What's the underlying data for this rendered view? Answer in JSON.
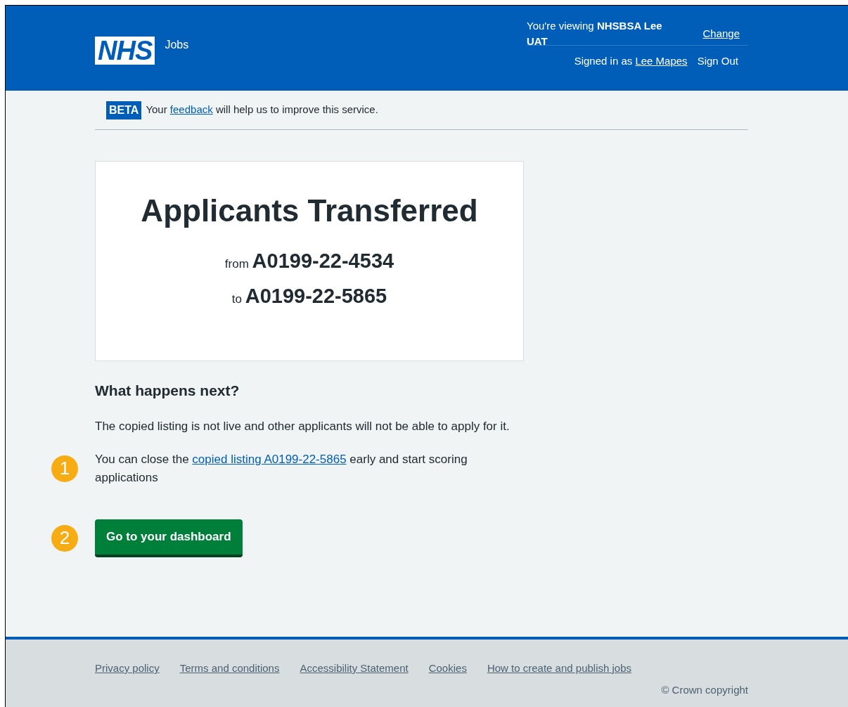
{
  "header": {
    "logo": "NHS",
    "service": "Jobs",
    "viewing_prefix": "You're viewing",
    "viewing_org": "NHSBSA Lee UAT",
    "change_link": "Change",
    "signed_in_prefix": "Signed in as",
    "user_link": "Lee Mapes",
    "sign_out": "Sign Out"
  },
  "beta_banner": {
    "tag": "BETA",
    "text_before": "Your",
    "link": "feedback",
    "text_after": "will help us to improve this service."
  },
  "panel": {
    "title": "Applicants Transferred",
    "from_label": "from",
    "from_ref": "A0199-22-4534",
    "to_label": "to",
    "to_ref": "A0199-22-5865"
  },
  "next": {
    "heading": "What happens next?",
    "paragraph": "The copied listing is not live and other applicants will not be able to apply for it.",
    "close_text_before": "You can close the",
    "close_link": "copied listing A0199-22-5865",
    "close_text_after": "early and start scoring applications",
    "close_marker": "1",
    "button": "Go to your dashboard",
    "button_marker": "2"
  },
  "footer": {
    "links": [
      "Privacy policy",
      "Terms and conditions",
      "Accessibility Statement",
      "Cookies",
      "How to create and publish jobs"
    ],
    "copyright": "© Crown copyright"
  }
}
